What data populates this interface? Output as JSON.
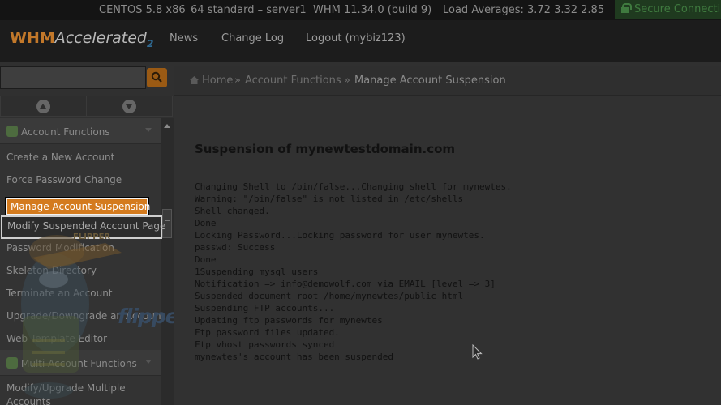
{
  "statusbar": {
    "os": "CENTOS 5.8 x86_64 standard – server1",
    "version": "WHM 11.34.0 (build 9)",
    "load": "Load Averages: 3.72 3.32 2.85",
    "secure": "Secure Connecti"
  },
  "header": {
    "logo_w": "WHM",
    "logo_accel": "Accelerated",
    "logo_num": "2",
    "nav": [
      "News",
      "Change Log",
      "Logout (mybiz123)"
    ]
  },
  "search": {
    "placeholder": ""
  },
  "sidebar": {
    "section1": "Account Functions",
    "items": [
      "Create a New Account",
      "Force Password Change",
      "Manage Account Suspension",
      "Modify Suspended Account Page",
      "Password Modification",
      "Skeleton Directory",
      "Terminate an Account",
      "Upgrade/Downgrade an Account",
      "Web Template Editor"
    ],
    "section2": "Multi Account Functions",
    "items2": [
      "Modify/Upgrade Multiple",
      "Accounts"
    ]
  },
  "watermark": {
    "mascot": "FLIPPER",
    "brand": "flipperHost"
  },
  "breadcrumb": [
    "Home",
    "Account Functions",
    "Manage Account Suspension"
  ],
  "main": {
    "title": "Suspension of mynewtestdomain.com",
    "log": [
      "Changing Shell to /bin/false...Changing shell for mynewtes.",
      "Warning: \"/bin/false\" is not listed in /etc/shells",
      "Shell changed.",
      "Done",
      "Locking Password...Locking password for user mynewtes.",
      "passwd: Success",
      "Done",
      "1Suspending mysql users",
      "Notification => info@demowolf.com via EMAIL [level => 3]",
      "Suspended document root /home/mynewtes/public_html",
      "Suspending FTP accounts...",
      "Updating ftp passwords for mynewtes",
      "Ftp password files updated.",
      "Ftp vhost passwords synced",
      "mynewtes's account has been suspended"
    ]
  },
  "colors": {
    "accent": "#d47b1e",
    "background": "#303030",
    "status_bar": "#141414"
  }
}
